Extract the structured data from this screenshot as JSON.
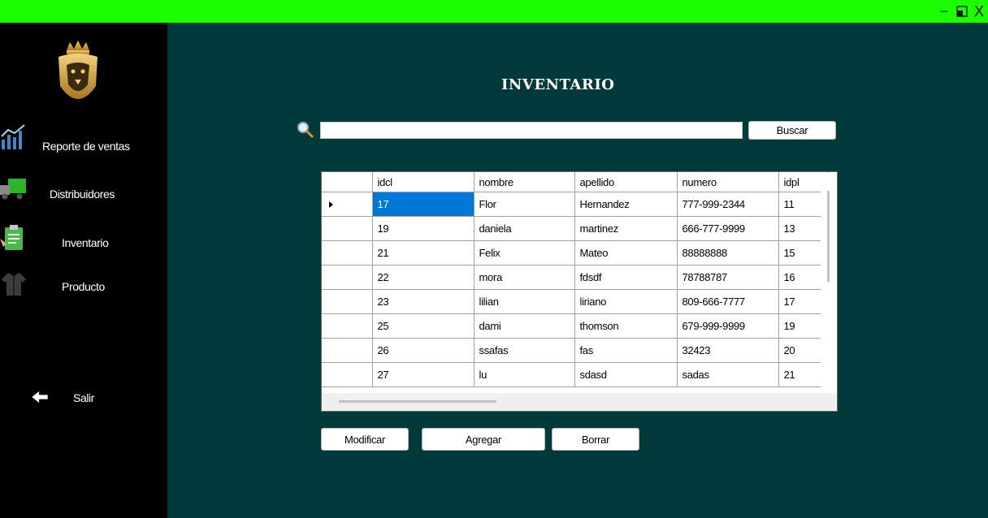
{
  "window": {
    "minimize": "−",
    "restore": "◱",
    "close": "X"
  },
  "sidebar": {
    "items": [
      {
        "label": "Reporte de ventas",
        "icon": "chart-icon"
      },
      {
        "label": "Distribuidores",
        "icon": "truck-icon"
      },
      {
        "label": "Inventario",
        "icon": "clipboard-icon"
      },
      {
        "label": "Producto",
        "icon": "jacket-icon"
      }
    ],
    "exit": {
      "label": "Salir",
      "icon": "arrow-left-icon"
    }
  },
  "main": {
    "title": "INVENTARIO",
    "search": {
      "value": "",
      "button": "Buscar"
    },
    "table": {
      "columns": [
        "idcl",
        "nombre",
        "apellido",
        "numero",
        "idpl"
      ],
      "rows": [
        [
          "17",
          "Flor",
          "Hernandez",
          "777-999-2344",
          "11"
        ],
        [
          "19",
          "daniela",
          "martinez",
          "666-777-9999",
          "13"
        ],
        [
          "21",
          "Felix",
          "Mateo",
          "88888888",
          "15"
        ],
        [
          "22",
          "mora",
          "fdsdf",
          "78788787",
          "16"
        ],
        [
          "23",
          "lilian",
          "liriano",
          "809-666-7777",
          "17"
        ],
        [
          "25",
          "dami",
          "thomson",
          "679-999-9999",
          "19"
        ],
        [
          "26",
          "ssafas",
          "fas",
          "32423",
          "20"
        ],
        [
          "27",
          "lu",
          "sdasd",
          "sadas",
          "21"
        ]
      ]
    },
    "actions": {
      "modify": "Modificar",
      "add": "Agregar",
      "delete": "Borrar"
    }
  },
  "colors": {
    "titlebar": "#1cff00",
    "background": "#02393b",
    "sidebar": "#000000",
    "selection": "#0078d7"
  }
}
